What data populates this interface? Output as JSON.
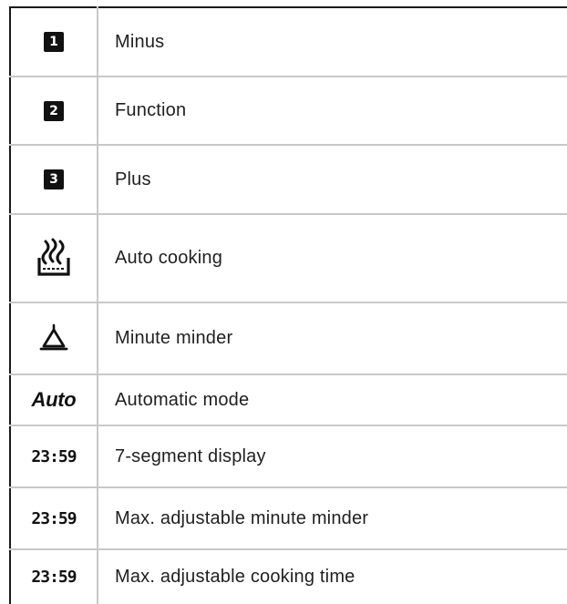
{
  "rows": [
    {
      "symbol": "1",
      "label": "Minus"
    },
    {
      "symbol": "2",
      "label": "Function"
    },
    {
      "symbol": "3",
      "label": "Plus"
    },
    {
      "symbol": "auto-cooking-icon",
      "label": "Auto cooking"
    },
    {
      "symbol": "bell-icon",
      "label": "Minute minder"
    },
    {
      "symbol": "Auto",
      "label": "Automatic mode"
    },
    {
      "symbol": "23:59",
      "label": "7-segment display"
    },
    {
      "symbol": "23:59",
      "label": "Max. adjustable minute minder"
    },
    {
      "symbol": "23:59",
      "label": "Max. adjustable cooking time"
    }
  ]
}
